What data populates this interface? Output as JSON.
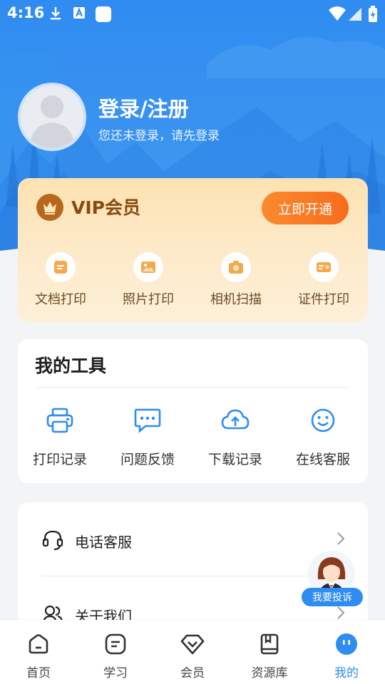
{
  "status_bar": {
    "time": "4:16"
  },
  "profile": {
    "title": "登录/注册",
    "subtitle": "您还未登录，请先登录"
  },
  "vip": {
    "title": "VIP会员",
    "button_label": "立即开通",
    "features": [
      {
        "label": "文档打印",
        "icon": "document-print-icon"
      },
      {
        "label": "照片打印",
        "icon": "photo-print-icon"
      },
      {
        "label": "相机扫描",
        "icon": "camera-scan-icon"
      },
      {
        "label": "证件打印",
        "icon": "id-card-print-icon"
      }
    ]
  },
  "tools": {
    "title": "我的工具",
    "items": [
      {
        "label": "打印记录",
        "icon": "printer-icon"
      },
      {
        "label": "问题反馈",
        "icon": "chat-feedback-icon"
      },
      {
        "label": "下载记录",
        "icon": "cloud-upload-icon"
      },
      {
        "label": "在线客服",
        "icon": "smiley-icon"
      }
    ]
  },
  "list": {
    "items": [
      {
        "label": "电话客服",
        "icon": "headset-icon"
      },
      {
        "label": "关于我们",
        "icon": "users-icon"
      }
    ]
  },
  "complain": {
    "label": "我要投诉"
  },
  "tabbar": {
    "items": [
      {
        "label": "首页",
        "icon": "home-icon"
      },
      {
        "label": "学习",
        "icon": "study-icon"
      },
      {
        "label": "会员",
        "icon": "diamond-icon"
      },
      {
        "label": "资源库",
        "icon": "book-icon"
      },
      {
        "label": "我的",
        "icon": "profile-icon",
        "active": true
      }
    ]
  },
  "colors": {
    "primary": "#2f8cf0",
    "vip_text": "#8a4a0f",
    "vip_button": "#f76c1d",
    "vip_icon": "#f4a84a"
  }
}
